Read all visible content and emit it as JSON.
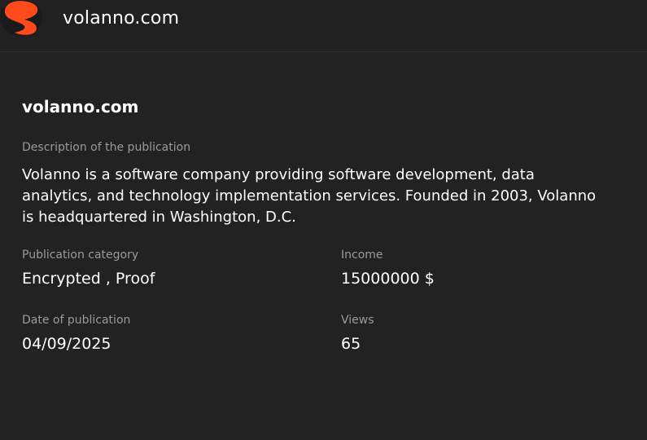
{
  "header": {
    "site_name": "volanno.com",
    "logo_icon": "volanno-logo-icon",
    "logo_color": "#ff4a1c"
  },
  "publication": {
    "title": "volanno.com",
    "description_label": "Description of the publication",
    "description": "Volanno is a software company providing software development, data analytics, and technology implementation services. Founded in 2003, Volanno is headquartered in Washington, D.C.",
    "fields": {
      "category": {
        "label": "Publication category",
        "value": "Encrypted , Proof"
      },
      "income": {
        "label": "Income",
        "value": "15000000 $"
      },
      "date": {
        "label": "Date of publication",
        "value": "04/09/2025"
      },
      "views": {
        "label": "Views",
        "value": "65"
      }
    }
  },
  "colors": {
    "background": "#222222",
    "label": "#9a9a9a",
    "text": "#ffffff"
  }
}
